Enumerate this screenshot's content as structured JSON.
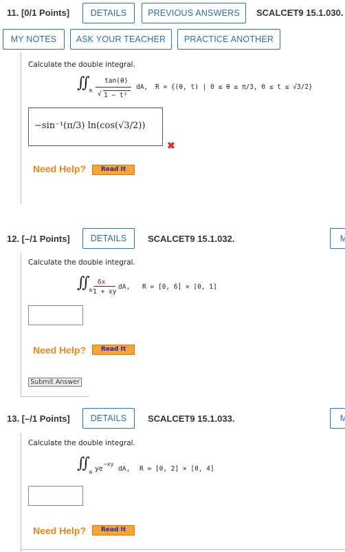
{
  "q11": {
    "title": "11.  [0/1 Points]",
    "details": "DETAILS",
    "previous": "PREVIOUS ANSWERS",
    "code": "SCALCET9 15.1.030.",
    "my_notes": "MY NOTES",
    "ask_teacher": "ASK YOUR TEACHER",
    "practice": "PRACTICE ANOTHER",
    "instruction": "Calculate the double integral.",
    "integrand_num": "tan(θ)",
    "integrand_den": "1 − t²",
    "diff": "dA,",
    "region": "R = {(θ, t) | 0 ≤ θ ≤ π/3, 0 ≤ t ≤ √3/2}",
    "answer": "−sin⁻¹(π/3) ln(cos(√3/2))",
    "need_help": "Need Help?",
    "read_it": "Read It"
  },
  "q12": {
    "title": "12.  [–/1 Points]",
    "details": "DETAILS",
    "code": "SCALCET9 15.1.032.",
    "instruction": "Calculate the double integral.",
    "integrand_num": "6x",
    "integrand_den": "1 + xy",
    "diff": "dA,",
    "region": "R = [0, 6] × [0, 1]",
    "need_help": "Need Help?",
    "read_it": "Read It",
    "submit": "Submit Answer"
  },
  "q13": {
    "title": "13.  [–/1 Points]",
    "details": "DETAILS",
    "code": "SCALCET9 15.1.033.",
    "instruction": "Calculate the double integral.",
    "integrand": "ye",
    "exponent": "−xy",
    "diff": "dA,",
    "region": "R = [0, 2] × [0, 4]",
    "need_help": "Need Help?",
    "read_it": "Read It"
  },
  "edge_label": "M",
  "colors": {
    "link": "#2d6ea3",
    "help": "#e8861e",
    "wrong": "#d9342b"
  }
}
